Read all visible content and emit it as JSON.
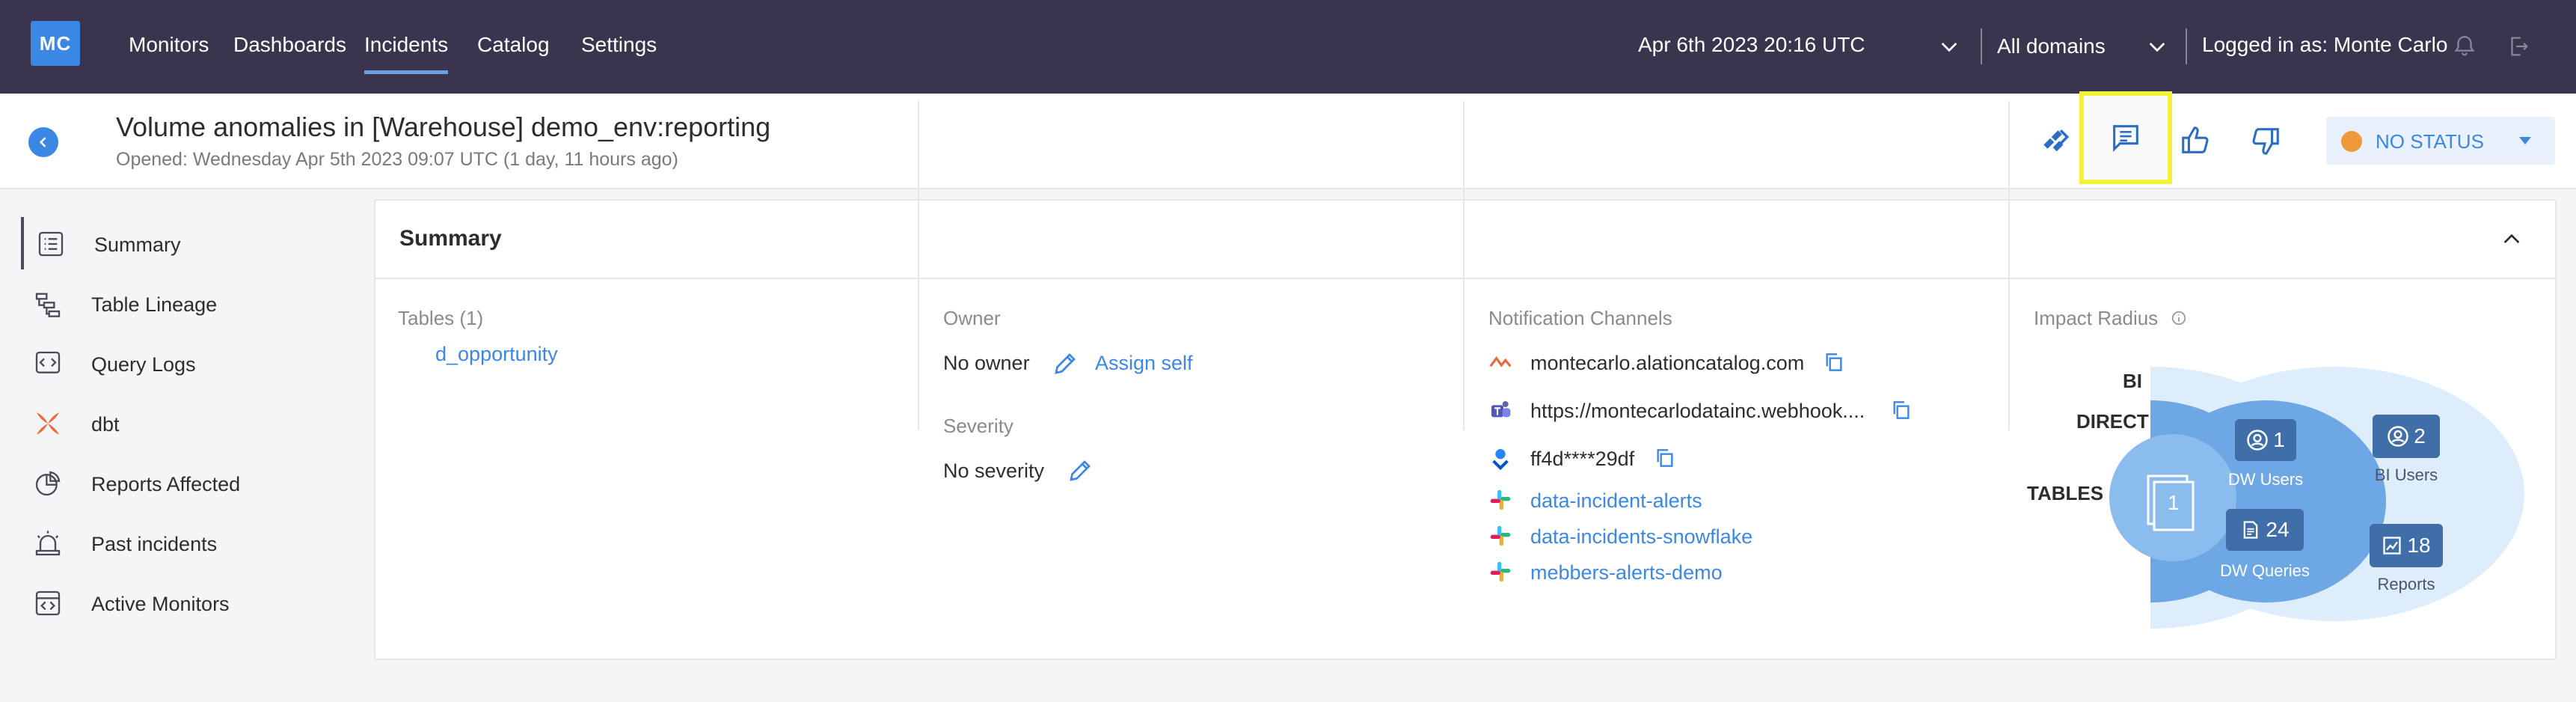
{
  "nav": {
    "logo": "MC",
    "links": [
      "Monitors",
      "Dashboards",
      "Incidents",
      "Catalog",
      "Settings"
    ],
    "active": "Incidents",
    "date": "Apr 6th 2023 20:16 UTC",
    "domains": "All domains",
    "user": "Logged in as: Monte Carlo"
  },
  "header": {
    "title": "Volume anomalies in [Warehouse] demo_env:reporting",
    "subtitle": "Opened: Wednesday Apr 5th 2023 09:07 UTC (1 day, 11 hours ago)",
    "status": "NO STATUS",
    "icons": [
      "jira-icon",
      "comment-icon",
      "thumbs-up-icon",
      "thumbs-down-icon"
    ]
  },
  "sidebar": {
    "items": [
      {
        "label": "Summary",
        "icon": "list-icon"
      },
      {
        "label": "Table Lineage",
        "icon": "lineage-icon"
      },
      {
        "label": "Query Logs",
        "icon": "code-icon"
      },
      {
        "label": "dbt",
        "icon": "dbt-icon"
      },
      {
        "label": "Reports Affected",
        "icon": "pie-chart-icon"
      },
      {
        "label": "Past incidents",
        "icon": "siren-icon"
      },
      {
        "label": "Active Monitors",
        "icon": "monitor-icon"
      }
    ]
  },
  "summary": {
    "title": "Summary",
    "tables": {
      "label": "Tables (1)",
      "items": [
        "d_opportunity"
      ]
    },
    "owner": {
      "label": "Owner",
      "value": "No owner",
      "action": "Assign self"
    },
    "severity": {
      "label": "Severity",
      "value": "No severity"
    },
    "notifications": {
      "label": "Notification Channels",
      "channels": [
        {
          "text": "montecarlo.alationcatalog.com",
          "icon": "alation-icon",
          "copy": true,
          "link": false
        },
        {
          "text": "https://montecarlodatainc.webhook....",
          "icon": "teams-icon",
          "copy": true,
          "link": false
        },
        {
          "text": "ff4d****29df",
          "icon": "opsgenie-icon",
          "copy": true,
          "link": false
        },
        {
          "text": "data-incident-alerts",
          "icon": "slack-icon",
          "copy": false,
          "link": true
        },
        {
          "text": "data-incidents-snowflake",
          "icon": "slack-icon",
          "copy": false,
          "link": true
        },
        {
          "text": "mebbers-alerts-demo",
          "icon": "slack-icon",
          "copy": false,
          "link": true
        }
      ]
    },
    "impact": {
      "label": "Impact Radius",
      "rows": [
        "BI",
        "DIRECT",
        "TABLES"
      ],
      "tables_count": "1",
      "dw_users": {
        "count": "1",
        "label": "DW Users"
      },
      "dw_queries": {
        "count": "24",
        "label": "DW Queries"
      },
      "bi_users": {
        "count": "2",
        "label": "BI Users"
      },
      "reports": {
        "count": "18",
        "label": "Reports"
      }
    }
  },
  "colors": {
    "nav_bg": "#3a344e",
    "accent": "#3b87e4",
    "status_dot": "#ee9a3a",
    "highlight": "#f2f23a"
  }
}
